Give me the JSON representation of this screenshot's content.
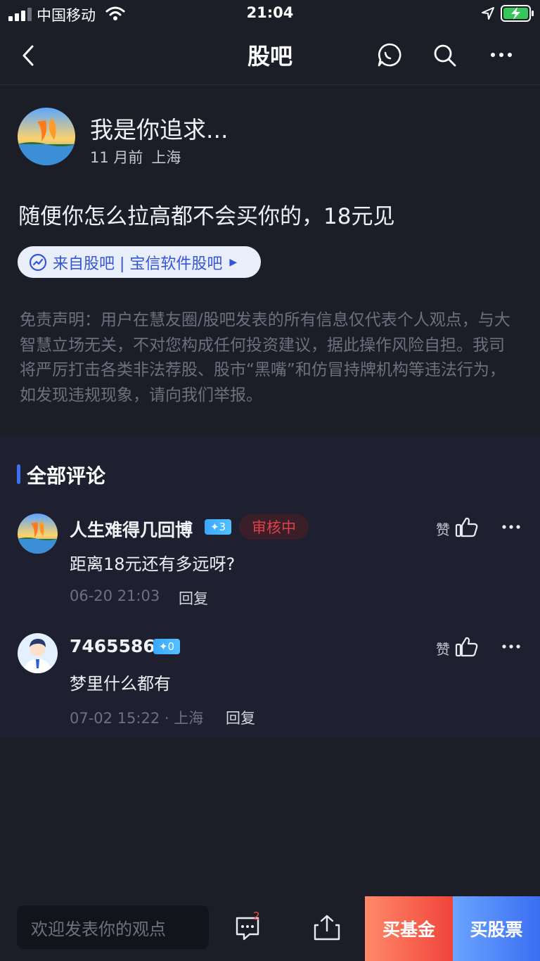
{
  "status_bar": {
    "carrier": "中国移动",
    "time": "21:04"
  },
  "nav": {
    "title": "股吧"
  },
  "post": {
    "author": "我是你追求...",
    "time_ago": "11 月前",
    "location": "上海",
    "content": "随便你怎么拉高都不会买你的，18元见",
    "source": "来自股吧 | 宝信软件股吧",
    "disclaimer": "免责声明：用户在慧友圈/股吧发表的所有信息仅代表个人观点，与大智慧立场无关，不对您构成任何投资建议，据此操作风险自担。我司将严厉打击各类非法荐股、股市“黑嘴”和仿冒持牌机构等违法行为，如发现违规现象，请向我们举报。"
  },
  "comments_section": {
    "title": "全部评论",
    "items": [
      {
        "username": "人生难得几回博",
        "level": "✦3",
        "review_status": "审核中",
        "like_label": "赞",
        "text": "距离18元还有多远呀?",
        "time": "06-20 21:03",
        "reply_label": "回复"
      },
      {
        "username": "7465586",
        "level": "✦0",
        "like_label": "赞",
        "text": "梦里什么都有",
        "time": "07-02 15:22 · 上海",
        "reply_label": "回复"
      }
    ]
  },
  "bottom_bar": {
    "input_placeholder": "欢迎发表你的观点",
    "comment_count": "2",
    "buy_fund": "买基金",
    "buy_stock": "买股票"
  },
  "colors": {
    "background": "#1b1d27",
    "accent_blue": "#3f6ff7",
    "review_red": "#e0404a",
    "battery_green": "#35c759"
  },
  "icons": [
    "signal-icon",
    "wifi-icon",
    "location-arrow-icon",
    "battery-charging-icon",
    "back-icon",
    "chat-icon",
    "search-icon",
    "more-icon",
    "trend-link-icon",
    "like-icon",
    "comment-icon",
    "share-icon"
  ]
}
